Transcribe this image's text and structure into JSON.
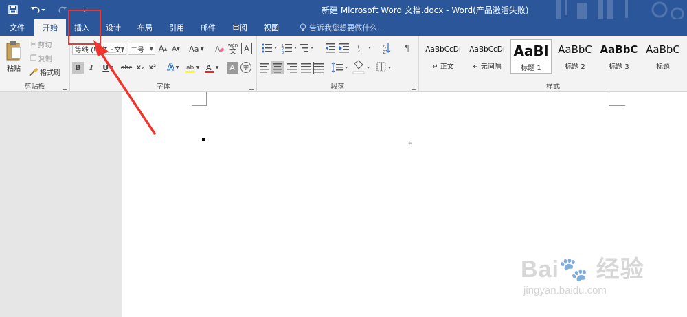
{
  "window": {
    "title": "新建 Microsoft Word 文档.docx - Word(产品激活失败)"
  },
  "qat": {
    "save_icon": "save-icon",
    "undo_icon": "undo-icon",
    "redo_icon": "redo-icon"
  },
  "tabs": [
    {
      "label": "文件"
    },
    {
      "label": "开始"
    },
    {
      "label": "插入"
    },
    {
      "label": "设计"
    },
    {
      "label": "布局"
    },
    {
      "label": "引用"
    },
    {
      "label": "邮件"
    },
    {
      "label": "审阅"
    },
    {
      "label": "视图"
    }
  ],
  "tell_me": {
    "placeholder": "告诉我您想要做什么..."
  },
  "clipboard": {
    "paste": "粘贴",
    "cut": "剪切",
    "copy": "复制",
    "format_painter": "格式刷",
    "group_label": "剪贴板"
  },
  "font": {
    "font_name": "等线 (中文正文)",
    "font_size": "二号",
    "group_label": "字体",
    "clear_format_glyph": "A",
    "phonetic": "wén",
    "phonetic_char": "文",
    "bold": "B",
    "italic": "I",
    "underline": "U",
    "strike": "abc",
    "subscript": "x₂",
    "superscript": "x²",
    "grow": "A",
    "shrink": "A",
    "change_case": "Aa",
    "font_color": "A",
    "char_shading": "A",
    "enclose": "字"
  },
  "paragraph": {
    "group_label": "段落"
  },
  "styles": {
    "group_label": "样式",
    "items": [
      {
        "sample": "AaBbCcDı",
        "name": "↵ 正文"
      },
      {
        "sample": "AaBbCcDı",
        "name": "↵ 无间隔"
      },
      {
        "sample": "AaBl",
        "name": "标题 1"
      },
      {
        "sample": "AaBbC",
        "name": "标题 2"
      },
      {
        "sample": "AaBbC",
        "name": "标题 3"
      },
      {
        "sample": "AaBbC",
        "name": "标题"
      }
    ]
  },
  "document": {
    "paragraph_mark": "↵"
  },
  "watermark": {
    "brand": "Bai🐾 经验",
    "url": "jingyan.baidu.com"
  },
  "colors": {
    "word_blue": "#2b579a",
    "annotation_red": "#f2342e"
  }
}
